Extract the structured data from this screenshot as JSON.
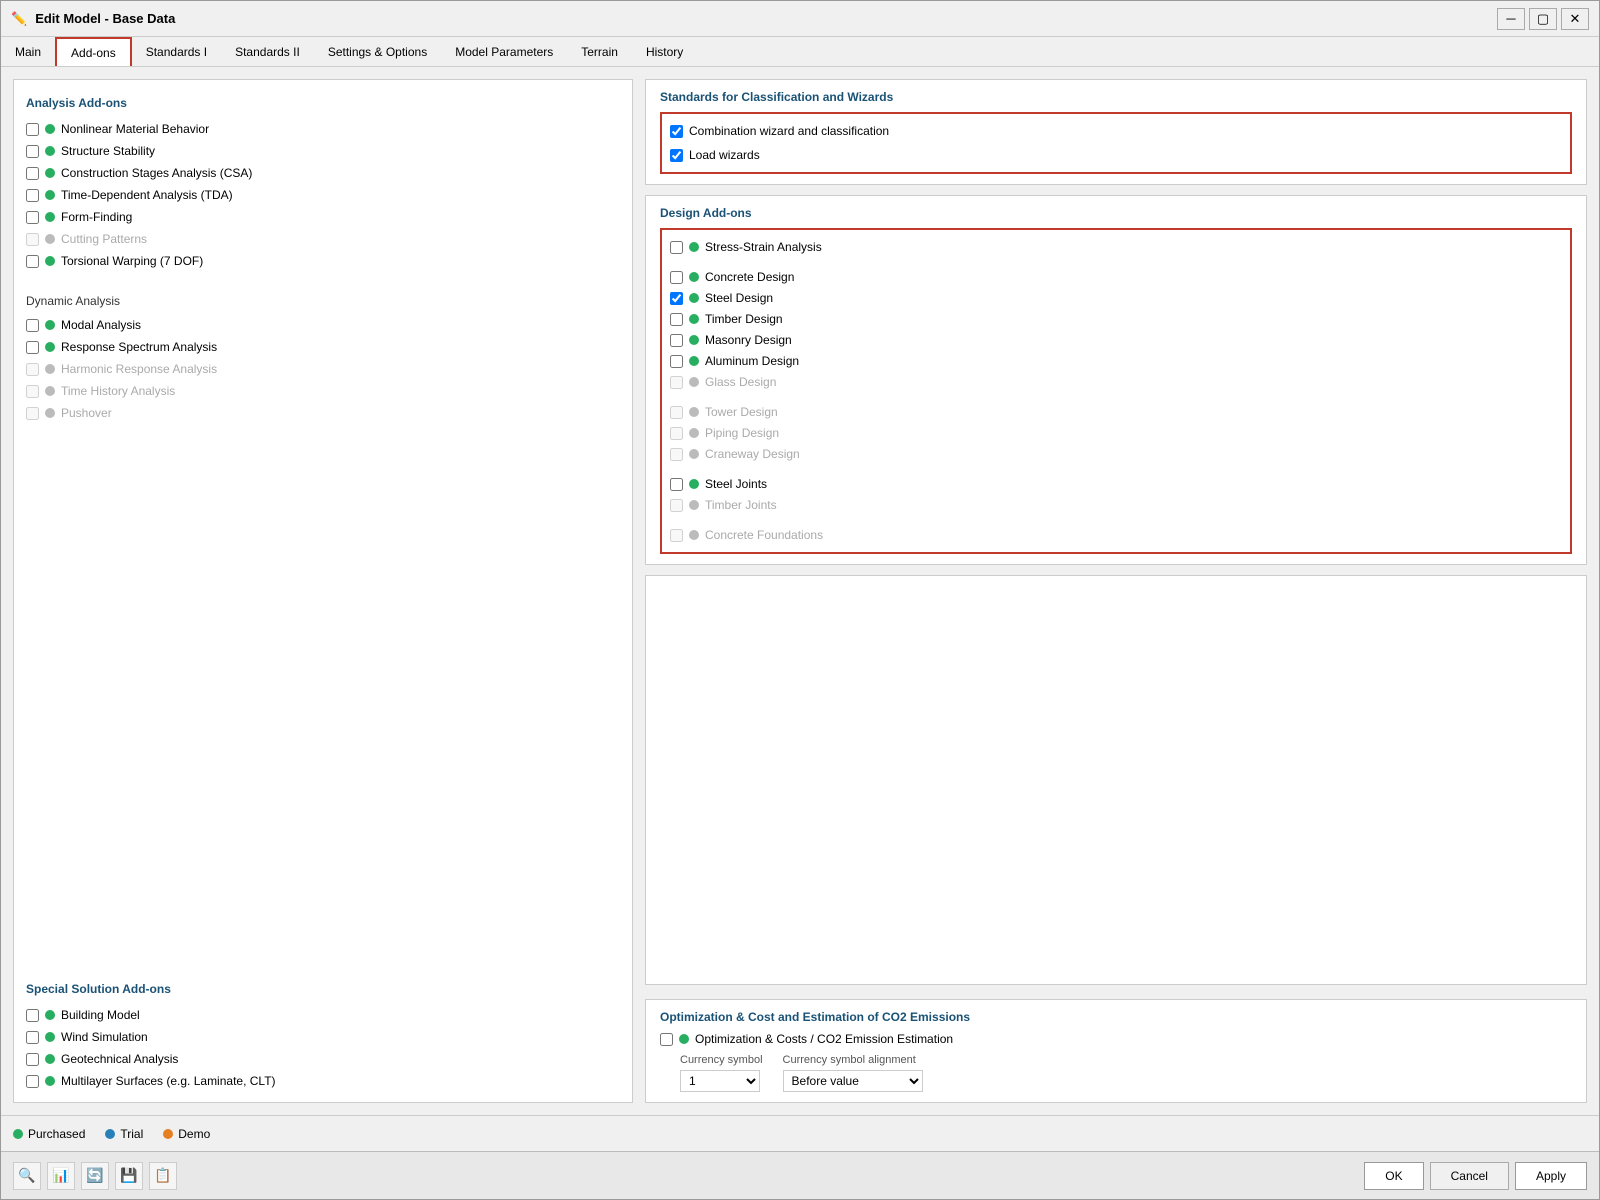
{
  "window": {
    "title": "Edit Model - Base Data",
    "icon": "✏️"
  },
  "tabs": [
    {
      "id": "main",
      "label": "Main",
      "active": false
    },
    {
      "id": "addons",
      "label": "Add-ons",
      "active": true
    },
    {
      "id": "standards1",
      "label": "Standards I",
      "active": false
    },
    {
      "id": "standards2",
      "label": "Standards II",
      "active": false
    },
    {
      "id": "settings",
      "label": "Settings & Options",
      "active": false
    },
    {
      "id": "model_params",
      "label": "Model Parameters",
      "active": false
    },
    {
      "id": "terrain",
      "label": "Terrain",
      "active": false
    },
    {
      "id": "history",
      "label": "History",
      "active": false
    }
  ],
  "left_panel": {
    "analysis_section": {
      "title": "Analysis Add-ons",
      "items": [
        {
          "id": "nonlinear",
          "label": "Nonlinear Material Behavior",
          "checked": false,
          "dot": "green",
          "disabled": false
        },
        {
          "id": "stability",
          "label": "Structure Stability",
          "checked": false,
          "dot": "green",
          "disabled": false
        },
        {
          "id": "csa",
          "label": "Construction Stages Analysis (CSA)",
          "checked": false,
          "dot": "green",
          "disabled": false
        },
        {
          "id": "tda",
          "label": "Time-Dependent Analysis (TDA)",
          "checked": false,
          "dot": "green",
          "disabled": false
        },
        {
          "id": "formfinding",
          "label": "Form-Finding",
          "checked": false,
          "dot": "green",
          "disabled": false
        },
        {
          "id": "cutting",
          "label": "Cutting Patterns",
          "checked": false,
          "dot": "gray",
          "disabled": true
        },
        {
          "id": "torsional",
          "label": "Torsional Warping (7 DOF)",
          "checked": false,
          "dot": "green",
          "disabled": false
        }
      ]
    },
    "dynamic_section": {
      "title": "Dynamic Analysis",
      "items": [
        {
          "id": "modal",
          "label": "Modal Analysis",
          "checked": false,
          "dot": "green",
          "disabled": false
        },
        {
          "id": "response",
          "label": "Response Spectrum Analysis",
          "checked": false,
          "dot": "green",
          "disabled": false
        },
        {
          "id": "harmonic",
          "label": "Harmonic Response Analysis",
          "checked": false,
          "dot": "gray",
          "disabled": true
        },
        {
          "id": "timehistory",
          "label": "Time History Analysis",
          "checked": false,
          "dot": "gray",
          "disabled": true
        },
        {
          "id": "pushover",
          "label": "Pushover",
          "checked": false,
          "dot": "gray",
          "disabled": true
        }
      ]
    },
    "special_section": {
      "title": "Special Solution Add-ons",
      "items": [
        {
          "id": "building",
          "label": "Building Model",
          "checked": false,
          "dot": "green",
          "disabled": false
        },
        {
          "id": "wind",
          "label": "Wind Simulation",
          "checked": false,
          "dot": "green",
          "disabled": false
        },
        {
          "id": "geotechnical",
          "label": "Geotechnical Analysis",
          "checked": false,
          "dot": "green",
          "disabled": false
        },
        {
          "id": "multilayer",
          "label": "Multilayer Surfaces (e.g. Laminate, CLT)",
          "checked": false,
          "dot": "green",
          "disabled": false
        }
      ]
    }
  },
  "right_panel": {
    "standards_section": {
      "title": "Standards for Classification and Wizards",
      "items": [
        {
          "id": "combination",
          "label": "Combination wizard and classification",
          "checked": true
        },
        {
          "id": "load_wizards",
          "label": "Load wizards",
          "checked": true
        }
      ]
    },
    "design_section": {
      "title": "Design Add-ons",
      "items": [
        {
          "id": "stress_strain",
          "label": "Stress-Strain Analysis",
          "checked": false,
          "dot": "green",
          "disabled": false
        },
        {
          "id": "concrete",
          "label": "Concrete Design",
          "checked": false,
          "dot": "green",
          "disabled": false
        },
        {
          "id": "steel",
          "label": "Steel Design",
          "checked": true,
          "dot": "green",
          "disabled": false
        },
        {
          "id": "timber",
          "label": "Timber Design",
          "checked": false,
          "dot": "green",
          "disabled": false
        },
        {
          "id": "masonry",
          "label": "Masonry Design",
          "checked": false,
          "dot": "green",
          "disabled": false
        },
        {
          "id": "aluminum",
          "label": "Aluminum Design",
          "checked": false,
          "dot": "green",
          "disabled": false
        },
        {
          "id": "glass",
          "label": "Glass Design",
          "checked": false,
          "dot": "gray",
          "disabled": true
        },
        {
          "id": "tower",
          "label": "Tower Design",
          "checked": false,
          "dot": "gray",
          "disabled": true
        },
        {
          "id": "piping",
          "label": "Piping Design",
          "checked": false,
          "dot": "gray",
          "disabled": true
        },
        {
          "id": "craneway",
          "label": "Craneway Design",
          "checked": false,
          "dot": "gray",
          "disabled": true
        },
        {
          "id": "steel_joints",
          "label": "Steel Joints",
          "checked": false,
          "dot": "green",
          "disabled": false
        },
        {
          "id": "timber_joints",
          "label": "Timber Joints",
          "checked": false,
          "dot": "gray",
          "disabled": true
        },
        {
          "id": "concrete_foundations",
          "label": "Concrete Foundations",
          "checked": false,
          "dot": "gray",
          "disabled": true
        }
      ]
    },
    "optimization_section": {
      "title": "Optimization & Cost and Estimation of CO2 Emissions",
      "items": [
        {
          "id": "optim",
          "label": "Optimization & Costs / CO2 Emission Estimation",
          "checked": false,
          "dot": "green",
          "disabled": false
        }
      ],
      "currency_symbol_label": "Currency symbol",
      "currency_alignment_label": "Currency symbol alignment",
      "currency_value": "1",
      "alignment_value": "Before value"
    }
  },
  "legend": {
    "items": [
      {
        "dot": "green",
        "label": "Purchased"
      },
      {
        "dot": "blue",
        "label": "Trial"
      },
      {
        "dot": "orange",
        "label": "Demo"
      }
    ]
  },
  "bottom_buttons": {
    "ok": "OK",
    "cancel": "Cancel",
    "apply": "Apply"
  }
}
